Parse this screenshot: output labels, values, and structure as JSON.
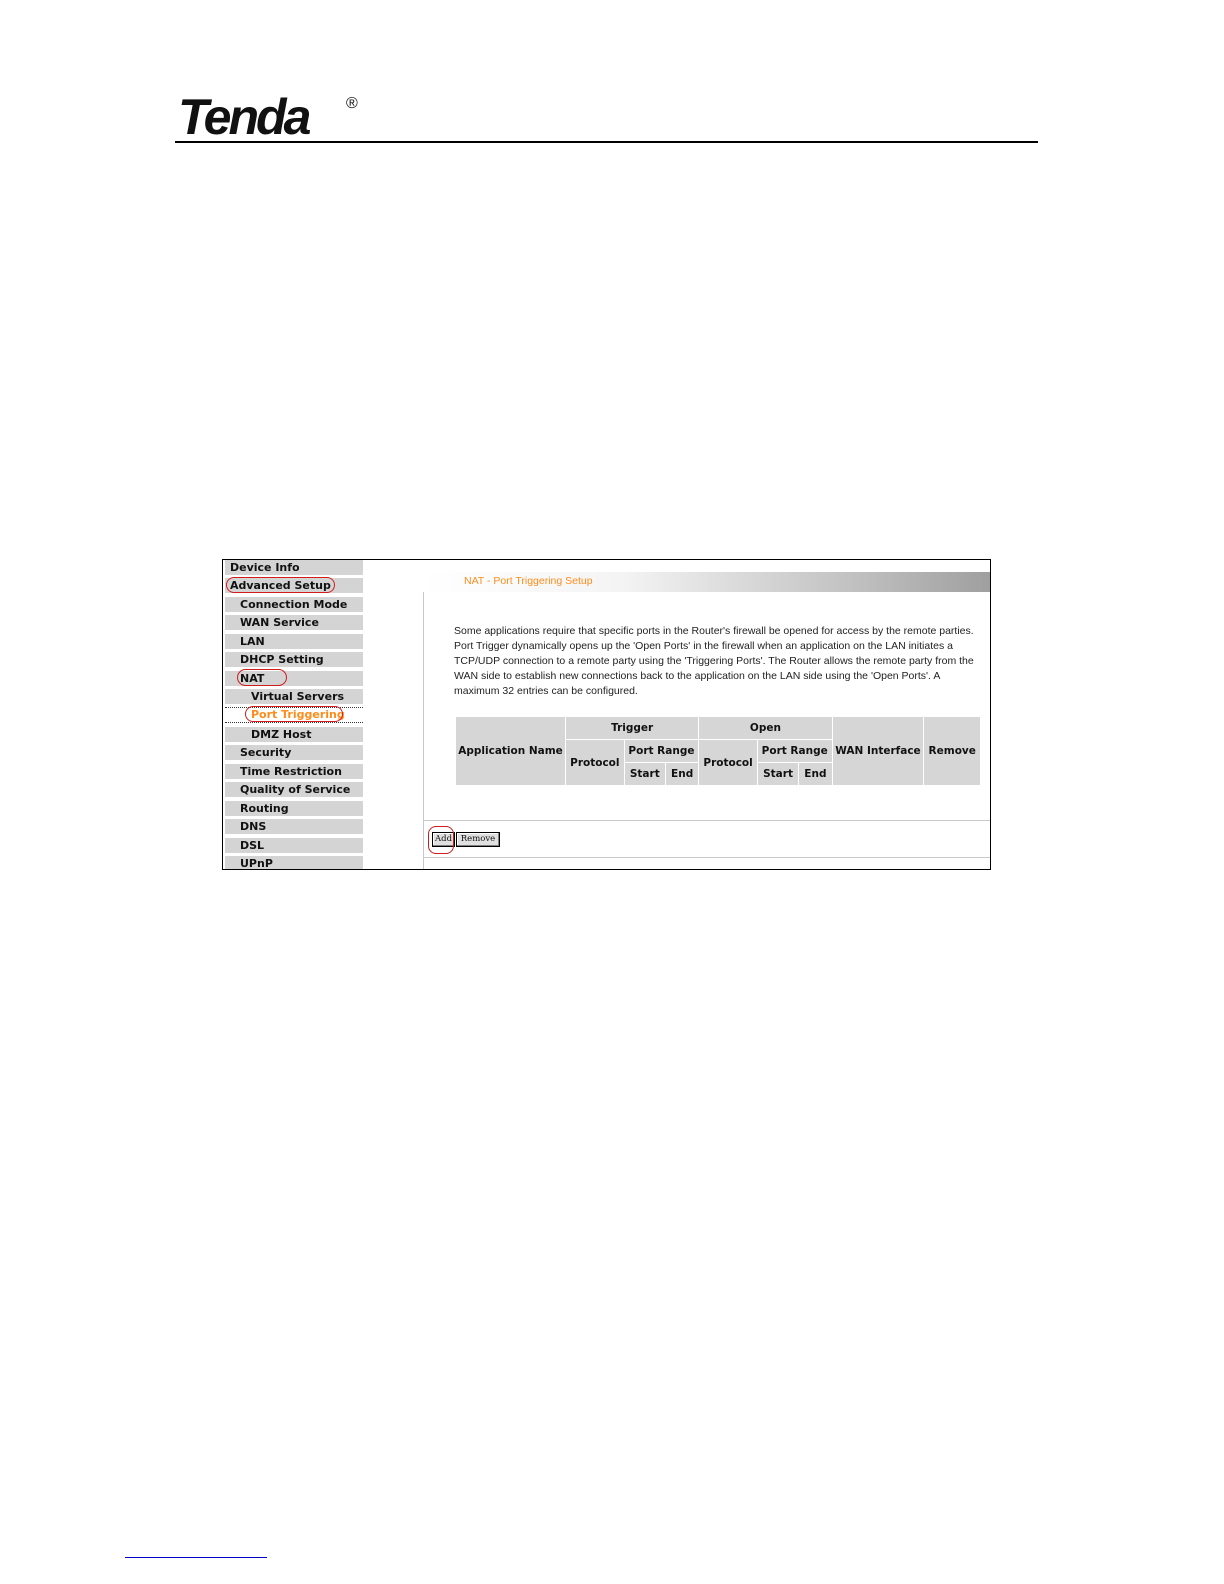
{
  "header": {
    "logo_text": "Tenda",
    "registered_mark": "®"
  },
  "sidebar": {
    "items": [
      {
        "label": "Device Info",
        "level": 0
      },
      {
        "label": "Advanced Setup",
        "level": 0,
        "circled": true
      },
      {
        "label": "Connection Mode",
        "level": 1
      },
      {
        "label": "WAN Service",
        "level": 1
      },
      {
        "label": "LAN",
        "level": 1
      },
      {
        "label": "DHCP Setting",
        "level": 1
      },
      {
        "label": "NAT",
        "level": 1,
        "circled": true
      },
      {
        "label": "Virtual Servers",
        "level": 2
      },
      {
        "label": "Port Triggering",
        "level": 2,
        "active": true,
        "circled": true
      },
      {
        "label": "DMZ Host",
        "level": 2
      },
      {
        "label": "Security",
        "level": 1
      },
      {
        "label": "Time Restriction",
        "level": 1
      },
      {
        "label": "Quality of Service",
        "level": 1
      },
      {
        "label": "Routing",
        "level": 1
      },
      {
        "label": "DNS",
        "level": 1
      },
      {
        "label": "DSL",
        "level": 1
      },
      {
        "label": "UPnP",
        "level": 1
      }
    ]
  },
  "main": {
    "title": "NAT  - Port Triggering Setup",
    "description": "Some applications require that specific ports in the Router's firewall be opened for access by the remote parties. Port Trigger dynamically opens up the 'Open Ports' in the firewall when an application on the LAN initiates a TCP/UDP connection to a remote party using the 'Triggering Ports'. The Router allows the remote party from the WAN side to establish new connections back to the application on the LAN side using the 'Open Ports'. A maximum 32 entries can be configured.",
    "table": {
      "application_name": "Application Name",
      "trigger": "Trigger",
      "open": "Open",
      "wan_interface": "WAN Interface",
      "remove": "Remove",
      "protocol": "Protocol",
      "port_range": "Port Range",
      "start": "Start",
      "end": "End"
    },
    "buttons": {
      "add": "Add",
      "remove": "Remove"
    }
  },
  "colors": {
    "accent": "#ff8c1a",
    "annotation": "#d21b1b",
    "nav_bg": "#d4d4d4",
    "header_cell_bg": "#d6d6d6"
  }
}
